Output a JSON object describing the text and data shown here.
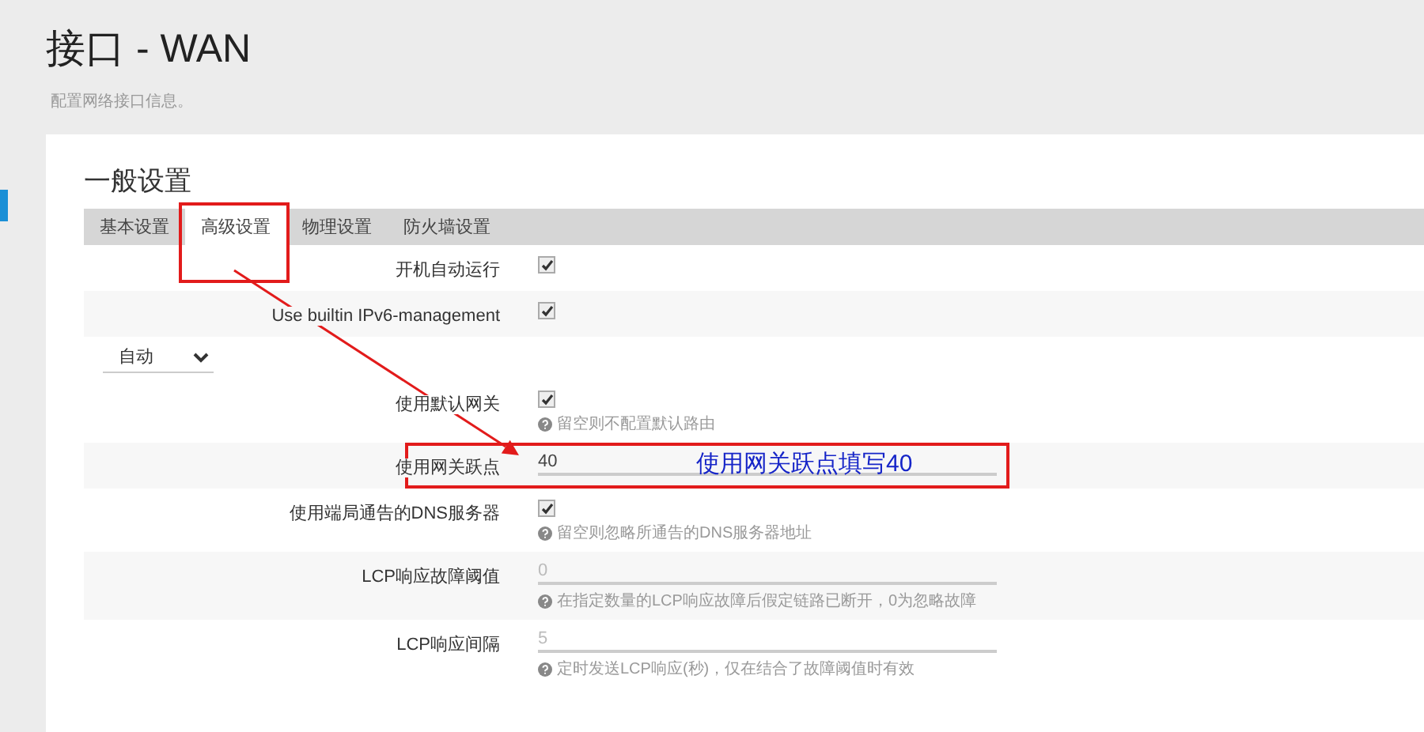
{
  "page": {
    "title": "接口 - WAN",
    "subtitle": "配置网络接口信息。"
  },
  "section": {
    "title": "一般设置",
    "tabs": [
      {
        "label": "基本设置",
        "selected": false,
        "highlighted": false
      },
      {
        "label": "高级设置",
        "selected": true,
        "highlighted": true
      },
      {
        "label": "物理设置",
        "selected": false,
        "highlighted": false
      },
      {
        "label": "防火墙设置",
        "selected": false,
        "highlighted": false
      }
    ],
    "rows": [
      {
        "kind": "checkbox",
        "label": "开机自动运行",
        "checked": true
      },
      {
        "kind": "checkbox",
        "label": "Use builtin IPv6-management",
        "checked": true
      },
      {
        "kind": "select",
        "value": "自动"
      },
      {
        "kind": "checkbox",
        "label": "使用默认网关",
        "checked": true,
        "hint": "留空则不配置默认路由"
      },
      {
        "kind": "text",
        "label": "使用网关跃点",
        "value": "40",
        "note": "使用网关跃点填写40"
      },
      {
        "kind": "checkbox",
        "label": "使用端局通告的DNS服务器",
        "checked": true,
        "hint": "留空则忽略所通告的DNS服务器地址"
      },
      {
        "kind": "text",
        "label": "LCP响应故障阈值",
        "placeholder": "0",
        "hint": "在指定数量的LCP响应故障后假定链路已断开，0为忽略故障"
      },
      {
        "kind": "text",
        "label": "LCP响应间隔",
        "placeholder": "5",
        "hint": "定时发送LCP响应(秒)，仅在结合了故障阈值时有效"
      }
    ]
  }
}
